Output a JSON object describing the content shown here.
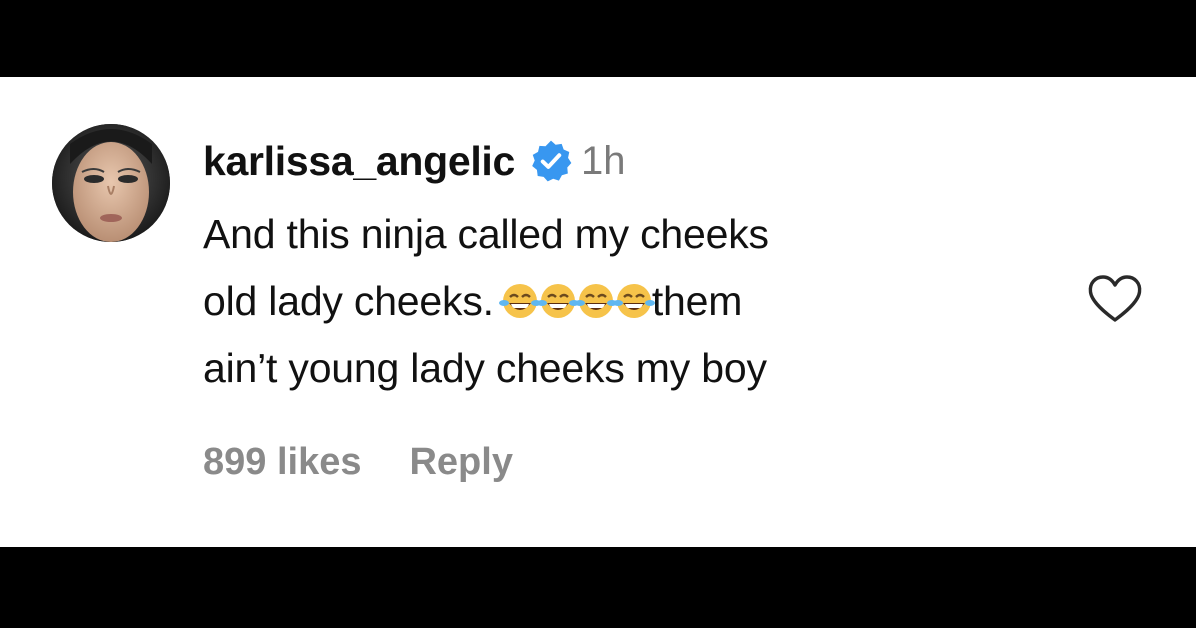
{
  "comment": {
    "username": "karlissa_angelic",
    "verified_icon": "verified-badge-icon",
    "timestamp": "1h",
    "lines": [
      "And this ninja called my cheeks",
      "old lady cheeks.",
      "them",
      "ain’t young lady cheeks my boy"
    ],
    "emoji": "face-with-tears-of-joy",
    "emoji_count": 4,
    "likes": "899 likes",
    "reply_label": "Reply",
    "like_icon": "heart-outline-icon"
  },
  "colors": {
    "frame": "#000000",
    "panel": "#ffffff",
    "text": "#111111",
    "muted": "#8a8a8a",
    "verified": "#3897f0"
  }
}
